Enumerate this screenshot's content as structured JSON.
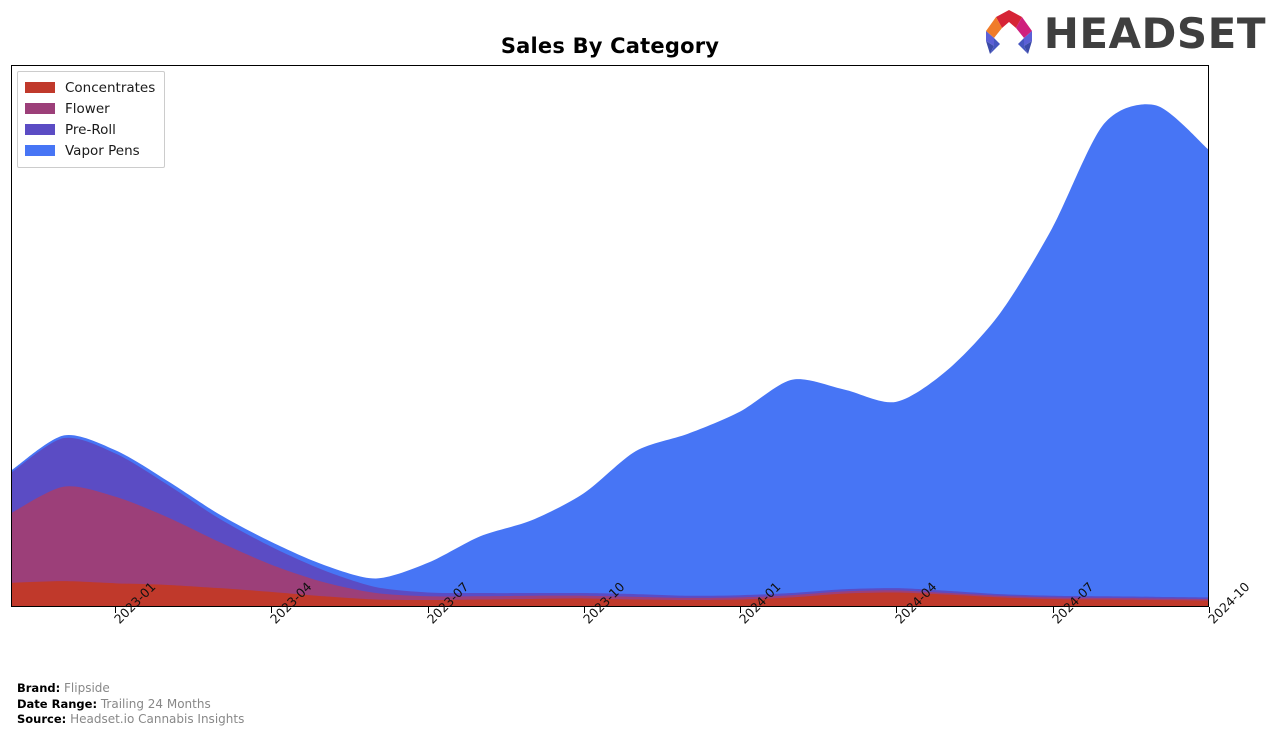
{
  "header": {
    "title": "Sales By Category",
    "logo_text": "HEADSET",
    "logo_icon": "headset-arch-logo"
  },
  "footer": {
    "rows": [
      {
        "key": "Brand:",
        "value": "Flipside"
      },
      {
        "key": "Date Range:",
        "value": "Trailing 24 Months"
      },
      {
        "key": "Source:",
        "value": "Headset.io Cannabis Insights"
      }
    ]
  },
  "colors": {
    "concentrates": "#c0392b",
    "flower": "#9c3f79",
    "preroll": "#5b4cc4",
    "vapor_pens": "#4775f5",
    "axis": "#000000",
    "legend_border": "#cccccc",
    "footer_value": "#888888"
  },
  "chart_data": {
    "type": "area",
    "stacked": true,
    "title": "Sales By Category",
    "xlabel": "",
    "ylabel": "",
    "grid": false,
    "legend_position": "top-left",
    "xlim": [
      "2022-11",
      "2024-10"
    ],
    "ylim": [
      0,
      100
    ],
    "tick_labels": [
      "2023-01",
      "2023-04",
      "2023-07",
      "2023-10",
      "2024-01",
      "2024-04",
      "2024-07",
      "2024-10"
    ],
    "x": [
      "2022-11",
      "2022-12",
      "2023-01",
      "2023-02",
      "2023-03",
      "2023-04",
      "2023-05",
      "2023-06",
      "2023-07",
      "2023-08",
      "2023-09",
      "2023-10",
      "2023-11",
      "2023-12",
      "2024-01",
      "2024-02",
      "2024-03",
      "2024-04",
      "2024-05",
      "2024-06",
      "2024-07",
      "2024-08",
      "2024-09",
      "2024-10"
    ],
    "series": [
      {
        "name": "Concentrates",
        "color": "#c0392b",
        "values": [
          4.3,
          4.6,
          4.2,
          3.9,
          3.3,
          2.6,
          1.8,
          1.2,
          1.1,
          1.2,
          1.3,
          1.4,
          1.2,
          1.1,
          1.2,
          1.6,
          2.3,
          2.5,
          2.1,
          1.6,
          1.3,
          1.2,
          1.1,
          1.0
        ]
      },
      {
        "name": "Flower",
        "color": "#9c3f79",
        "values": [
          13.0,
          17.5,
          16.0,
          12.5,
          8.5,
          5.0,
          2.6,
          1.2,
          0.7,
          0.6,
          0.6,
          0.5,
          0.5,
          0.4,
          0.4,
          0.4,
          0.4,
          0.4,
          0.3,
          0.3,
          0.3,
          0.3,
          0.3,
          0.3
        ]
      },
      {
        "name": "Pre-Roll",
        "color": "#5b4cc4",
        "values": [
          7.5,
          9.0,
          8.0,
          6.0,
          4.3,
          3.3,
          2.2,
          1.1,
          0.7,
          0.6,
          0.5,
          0.5,
          0.5,
          0.4,
          0.4,
          0.4,
          0.4,
          0.4,
          0.4,
          0.3,
          0.3,
          0.3,
          0.3,
          0.3
        ]
      },
      {
        "name": "Vapor Pens",
        "color": "#4775f5",
        "values": [
          0.4,
          0.5,
          0.6,
          0.7,
          0.8,
          0.9,
          1.0,
          1.6,
          5.5,
          10.5,
          13.5,
          18.5,
          26.5,
          30.0,
          34.0,
          39.5,
          37.0,
          34.5,
          41.0,
          52.0,
          68.0,
          87.5,
          91.0,
          83.0
        ]
      }
    ]
  },
  "legend": {
    "items": [
      {
        "label": "Concentrates",
        "color": "#c0392b"
      },
      {
        "label": "Flower",
        "color": "#9c3f79"
      },
      {
        "label": "Pre-Roll",
        "color": "#5b4cc4"
      },
      {
        "label": "Vapor Pens",
        "color": "#4775f5"
      }
    ]
  }
}
